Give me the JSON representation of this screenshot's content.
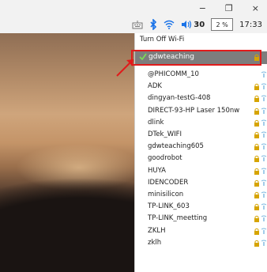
{
  "window_controls": {
    "minimize": "−",
    "maximize": "❐",
    "close": "×"
  },
  "taskbar": {
    "volume_value": "30",
    "cpu_label": "2 %",
    "time": "17:33"
  },
  "wifi_menu": {
    "turn_off_label": "Turn Off Wi-Fi",
    "connected_network": "gdwteaching",
    "networks": [
      {
        "name": "@PHICOMM_10",
        "locked": false
      },
      {
        "name": "ADK",
        "locked": true
      },
      {
        "name": "dingyan-testG-408",
        "locked": true
      },
      {
        "name": "DIRECT-93-HP Laser 150nw",
        "locked": true
      },
      {
        "name": "dlink",
        "locked": true
      },
      {
        "name": "DTek_WIFI",
        "locked": true
      },
      {
        "name": "gdwteaching605",
        "locked": true
      },
      {
        "name": "goodrobot",
        "locked": true
      },
      {
        "name": "HUYA",
        "locked": true
      },
      {
        "name": "IDENCODER",
        "locked": true
      },
      {
        "name": "minisilicon",
        "locked": true
      },
      {
        "name": "TP-LINK_603",
        "locked": true
      },
      {
        "name": "TP-LINK_meetting",
        "locked": true
      },
      {
        "name": "ZKLH",
        "locked": true
      },
      {
        "name": "zklh",
        "locked": true
      }
    ]
  },
  "colors": {
    "highlight_border": "#e01b1b",
    "selected_bg": "#7d7d7d",
    "bluetooth_icon": "#1a73e8",
    "lock_icon": "#d6a400"
  }
}
